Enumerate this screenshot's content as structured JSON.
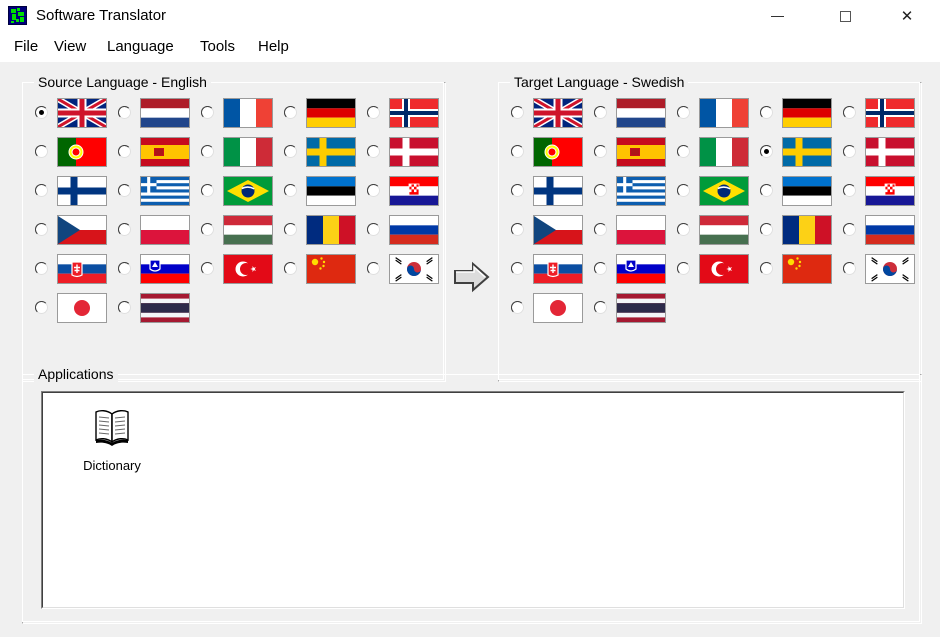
{
  "window": {
    "title": "Software Translator",
    "icon": "globe-icon",
    "controls": {
      "minimize": "—",
      "maximize": "□",
      "close": "✕"
    }
  },
  "menu": {
    "items": [
      {
        "label": "File"
      },
      {
        "label": "View"
      },
      {
        "label": "Language"
      },
      {
        "label": "Tools"
      },
      {
        "label": "Help"
      }
    ]
  },
  "source_panel": {
    "legend": "Source Language - English",
    "selected": "United Kingdom",
    "flags": [
      {
        "name": "United Kingdom",
        "code": "uk",
        "selected": true
      },
      {
        "name": "Netherlands",
        "code": "nl",
        "selected": false
      },
      {
        "name": "France",
        "code": "fr",
        "selected": false
      },
      {
        "name": "Germany",
        "code": "de",
        "selected": false
      },
      {
        "name": "Norway",
        "code": "no",
        "selected": false
      },
      {
        "name": "Portugal",
        "code": "pt",
        "selected": false
      },
      {
        "name": "Spain",
        "code": "es",
        "selected": false
      },
      {
        "name": "Italy",
        "code": "it",
        "selected": false
      },
      {
        "name": "Sweden",
        "code": "se",
        "selected": false
      },
      {
        "name": "Denmark",
        "code": "dk",
        "selected": false
      },
      {
        "name": "Finland",
        "code": "fi",
        "selected": false
      },
      {
        "name": "Greece",
        "code": "gr",
        "selected": false
      },
      {
        "name": "Brazil",
        "code": "br",
        "selected": false
      },
      {
        "name": "Estonia",
        "code": "ee",
        "selected": false
      },
      {
        "name": "Croatia",
        "code": "hr",
        "selected": false
      },
      {
        "name": "Czech Republic",
        "code": "cz",
        "selected": false
      },
      {
        "name": "Poland",
        "code": "pl",
        "selected": false
      },
      {
        "name": "Hungary",
        "code": "hu",
        "selected": false
      },
      {
        "name": "Romania",
        "code": "ro",
        "selected": false
      },
      {
        "name": "Russia",
        "code": "ru",
        "selected": false
      },
      {
        "name": "Slovakia",
        "code": "sk",
        "selected": false
      },
      {
        "name": "Slovenia",
        "code": "si",
        "selected": false
      },
      {
        "name": "Turkey",
        "code": "tr",
        "selected": false
      },
      {
        "name": "China",
        "code": "cn",
        "selected": false
      },
      {
        "name": "South Korea",
        "code": "kr",
        "selected": false
      },
      {
        "name": "Japan",
        "code": "jp",
        "selected": false
      },
      {
        "name": "Thailand",
        "code": "th",
        "selected": false
      }
    ]
  },
  "target_panel": {
    "legend": "Target Language - Swedish",
    "selected": "Sweden",
    "flags": [
      {
        "name": "United Kingdom",
        "code": "uk",
        "selected": false
      },
      {
        "name": "Netherlands",
        "code": "nl",
        "selected": false
      },
      {
        "name": "France",
        "code": "fr",
        "selected": false
      },
      {
        "name": "Germany",
        "code": "de",
        "selected": false
      },
      {
        "name": "Norway",
        "code": "no",
        "selected": false
      },
      {
        "name": "Portugal",
        "code": "pt",
        "selected": false
      },
      {
        "name": "Spain",
        "code": "es",
        "selected": false
      },
      {
        "name": "Italy",
        "code": "it",
        "selected": false
      },
      {
        "name": "Sweden",
        "code": "se",
        "selected": true
      },
      {
        "name": "Denmark",
        "code": "dk",
        "selected": false
      },
      {
        "name": "Finland",
        "code": "fi",
        "selected": false
      },
      {
        "name": "Greece",
        "code": "gr",
        "selected": false
      },
      {
        "name": "Brazil",
        "code": "br",
        "selected": false
      },
      {
        "name": "Estonia",
        "code": "ee",
        "selected": false
      },
      {
        "name": "Croatia",
        "code": "hr",
        "selected": false
      },
      {
        "name": "Czech Republic",
        "code": "cz",
        "selected": false
      },
      {
        "name": "Poland",
        "code": "pl",
        "selected": false
      },
      {
        "name": "Hungary",
        "code": "hu",
        "selected": false
      },
      {
        "name": "Romania",
        "code": "ro",
        "selected": false
      },
      {
        "name": "Russia",
        "code": "ru",
        "selected": false
      },
      {
        "name": "Slovakia",
        "code": "sk",
        "selected": false
      },
      {
        "name": "Slovenia",
        "code": "si",
        "selected": false
      },
      {
        "name": "Turkey",
        "code": "tr",
        "selected": false
      },
      {
        "name": "China",
        "code": "cn",
        "selected": false
      },
      {
        "name": "South Korea",
        "code": "kr",
        "selected": false
      },
      {
        "name": "Japan",
        "code": "jp",
        "selected": false
      },
      {
        "name": "Thailand",
        "code": "th",
        "selected": false
      }
    ]
  },
  "direction_arrow": {
    "icon": "arrow-right-icon"
  },
  "applications": {
    "legend": "Applications",
    "items": [
      {
        "label": "Dictionary",
        "icon": "book-icon"
      }
    ]
  },
  "colors": {
    "window_background": "#f0f0f0",
    "panel_background": "#ffffff",
    "border": "#a9a9a9",
    "text": "#000000"
  }
}
